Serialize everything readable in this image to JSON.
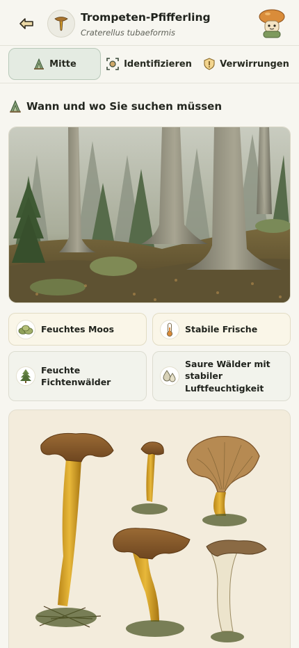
{
  "header": {
    "back_icon": "back-arrow-icon",
    "title": "Trompeten-Pfifferling",
    "subtitle": "Craterellus tubaeformis",
    "avatar_icon": "mushroom-icon",
    "mascot_icon": "mushroom-mascot-icon"
  },
  "tabs": [
    {
      "label": "Mitte",
      "icon": "habitat-icon",
      "active": true
    },
    {
      "label": "Identifizieren",
      "icon": "scan-icon",
      "active": false
    },
    {
      "label": "Verwirrungen",
      "icon": "warning-icon",
      "active": false
    }
  ],
  "section": {
    "heading": "Wann und wo Sie suchen müssen",
    "icon": "habitat-icon"
  },
  "habitat_cards": [
    {
      "label": "Feuchtes Moos",
      "icon": "moss-icon"
    },
    {
      "label": "Stabile Frische",
      "icon": "thermometer-icon"
    },
    {
      "label": "Feuchte Fichtenwälder",
      "icon": "spruce-tree-icon"
    },
    {
      "label": "Saure Wälder mit stabiler Luftfeuchtigkeit",
      "icon": "water-drops-icon"
    }
  ],
  "colors": {
    "background": "#f7f6f0",
    "active_tab": "#e4ebe2",
    "card_bg": "#faf6e8",
    "accent_green": "#4f6b4a",
    "mushroom_cap": "#8a5a2b",
    "mushroom_stem": "#d9a32a"
  }
}
